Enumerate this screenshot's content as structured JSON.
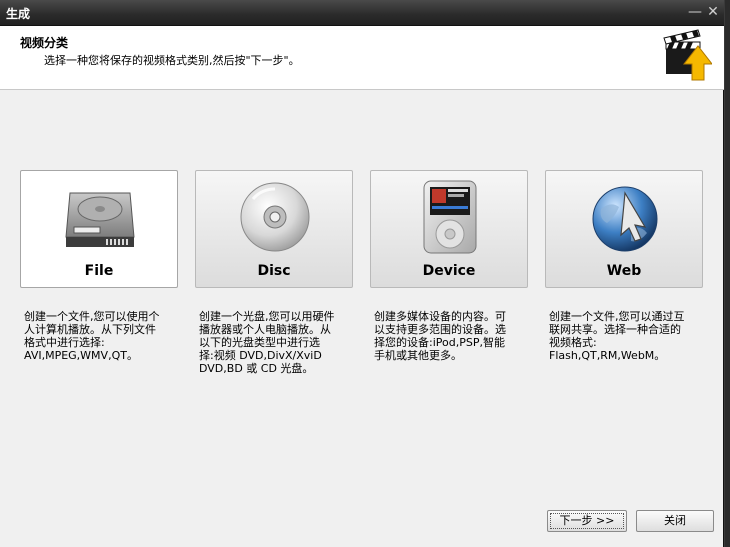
{
  "window": {
    "title": "生成",
    "minimize_glyph": "—",
    "close_glyph": "✕"
  },
  "header": {
    "title": "视频分类",
    "description": "选择一种您将保存的视频格式类别,然后按\"下一步\"。",
    "logo_icon": "clapperboard-arrow-icon"
  },
  "categories": [
    {
      "label": "File",
      "icon": "hard-drive-icon",
      "selected": true,
      "description_lines": [
        "创建一个文件,您可以使用个",
        "人计算机播放。从下列文件",
        "格式中进行选择:",
        "AVI,MPEG,WMV,QT。"
      ]
    },
    {
      "label": "Disc",
      "icon": "optical-disc-icon",
      "selected": false,
      "description_lines": [
        "创建一个光盘,您可以用硬件",
        "播放器或个人电脑播放。从",
        "以下的光盘类型中进行选",
        "择:视频 DVD,DivX/XviD",
        "DVD,BD 或 CD 光盘。"
      ]
    },
    {
      "label": "Device",
      "icon": "media-player-icon",
      "selected": false,
      "description_lines": [
        "创建多媒体设备的内容。可",
        "以支持更多范围的设备。选",
        "择您的设备:iPod,PSP,智能",
        "手机或其他更多。"
      ]
    },
    {
      "label": "Web",
      "icon": "globe-cursor-icon",
      "selected": false,
      "description_lines": [
        "创建一个文件,您可以通过互",
        "联网共享。选择一种合适的",
        "视频格式:",
        "Flash,QT,RM,WebM。"
      ]
    }
  ],
  "buttons": {
    "next_label": "下一步 >>",
    "close_label": "关闭"
  },
  "colors": {
    "titlebar": "#2a2a2a",
    "window_bg": "#f0f0f0",
    "header_bg": "#ffffff",
    "accent_yellow": "#f5b800"
  }
}
